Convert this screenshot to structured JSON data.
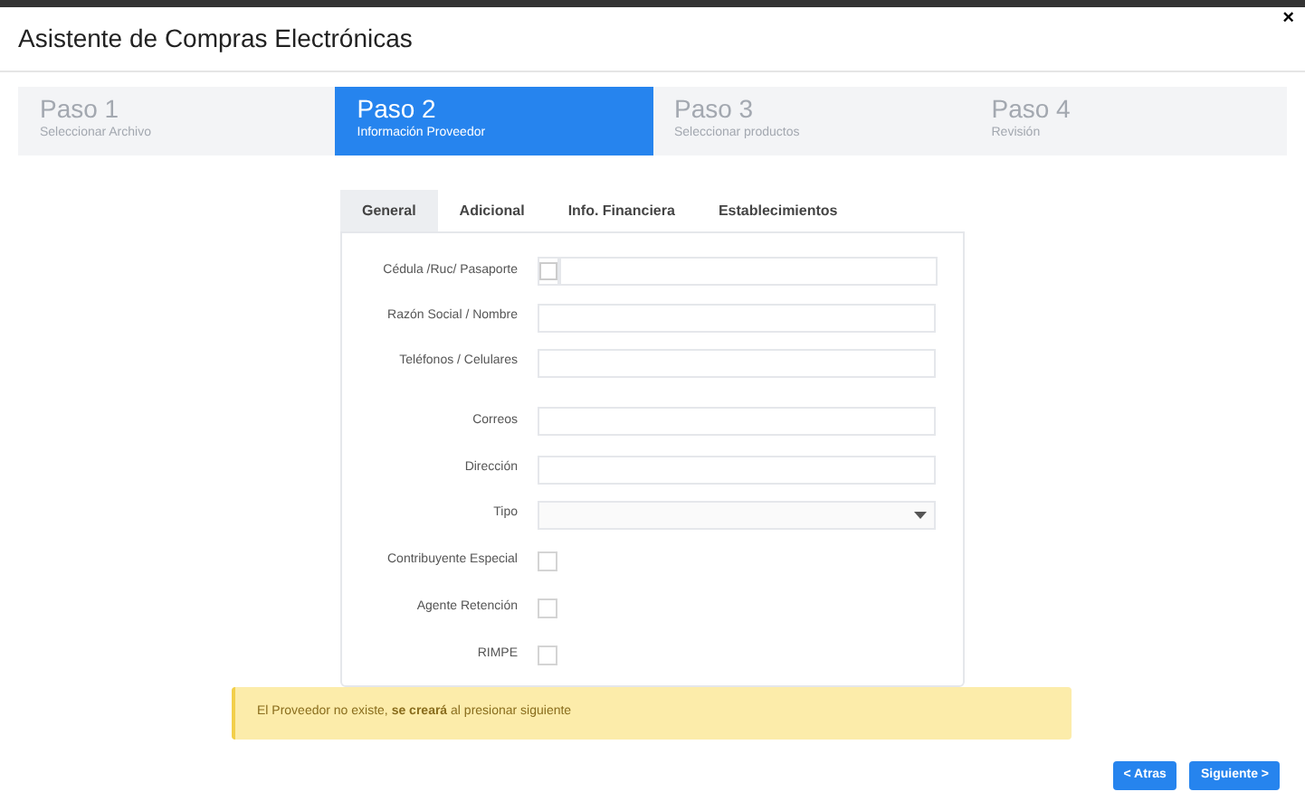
{
  "window": {
    "title": "Asistente de Compras Electrónicas",
    "close": "×"
  },
  "steps": [
    {
      "title": "Paso 1",
      "subtitle": "Seleccionar Archivo",
      "selected": false
    },
    {
      "title": "Paso 2",
      "subtitle": "Información Proveedor",
      "selected": true
    },
    {
      "title": "Paso 3",
      "subtitle": "Seleccionar productos",
      "selected": false
    },
    {
      "title": "Paso 4",
      "subtitle": "Revisión",
      "selected": false
    }
  ],
  "tabs": [
    {
      "label": "General",
      "selected": true
    },
    {
      "label": "Adicional",
      "selected": false
    },
    {
      "label": "Info. Financiera",
      "selected": false
    },
    {
      "label": "Establecimientos",
      "selected": false
    }
  ],
  "fields": [
    {
      "label": "Cédula /Ruc/ Pasaporte",
      "kind": "idfield",
      "checked": false
    },
    {
      "label": "Razón Social / Nombre",
      "kind": "text"
    },
    {
      "label": "Teléfonos / Celulares",
      "kind": "text"
    },
    {
      "label": "Correos",
      "kind": "text"
    },
    {
      "label": "Dirección",
      "kind": "text"
    },
    {
      "label": "Tipo",
      "kind": "select"
    },
    {
      "label": "Contribuyente Especial",
      "kind": "checkbox",
      "checked": false
    },
    {
      "label": "Agente Retención",
      "kind": "checkbox",
      "checked": false
    },
    {
      "label": "RIMPE",
      "kind": "checkbox",
      "checked": false
    }
  ],
  "alert": "El Proveedor no existe, **se creará** al presionar siguiente",
  "buttons": [
    "< Atras",
    "Siguiente >"
  ]
}
